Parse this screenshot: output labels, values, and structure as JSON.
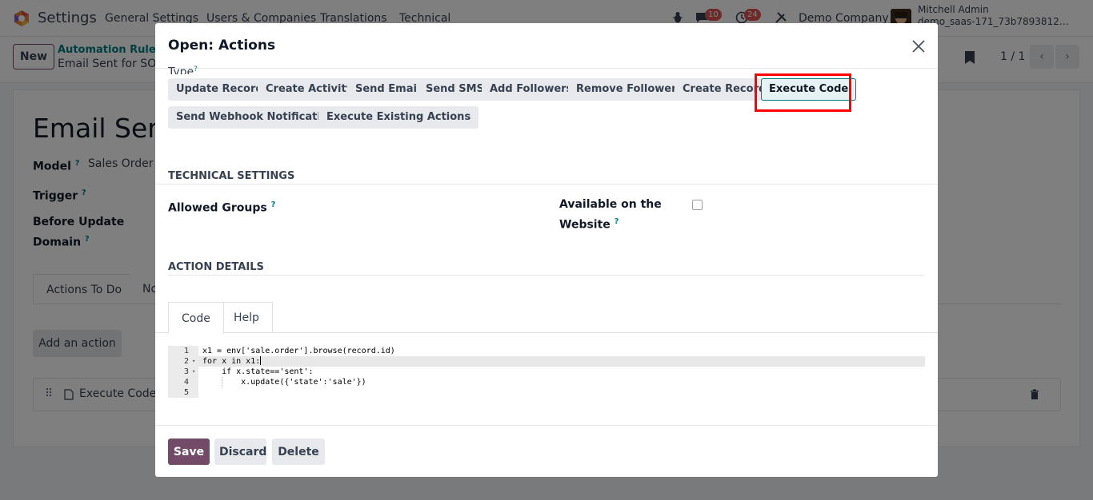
{
  "navbar": {
    "app_name": "Settings",
    "menus": [
      "General Settings",
      "Users & Companies",
      "Translations",
      "Technical"
    ],
    "messages_count": "10",
    "activities_count": "24",
    "company": "Demo Company",
    "user_name": "Mitchell Admin",
    "database": "demo_saas-171_73b7893812…"
  },
  "control_panel": {
    "new_label": "New",
    "breadcrumb_parent": "Automation Rules",
    "breadcrumb_current": "Email Sent for SO",
    "pager": "1 / 1"
  },
  "background_form": {
    "title": "Email Sent",
    "model_label": "Model",
    "model_value": "Sales Order",
    "trigger_label": "Trigger",
    "before_update_label": "Before Update",
    "domain_label": "Domain",
    "tab_actions": "Actions To Do",
    "tab_notes": "No",
    "add_action_label": "Add an action",
    "action_row_label": "Execute Code"
  },
  "modal": {
    "title": "Open: Actions",
    "type_label": "Type",
    "type_options": [
      "Update Record",
      "Create Activity",
      "Send Email",
      "Send SMS",
      "Add Followers",
      "Remove Followers",
      "Create Record",
      "Execute Code",
      "Send Webhook Notification",
      "Execute Existing Actions"
    ],
    "selected_type": "Execute Code",
    "technical_settings_title": "TECHNICAL SETTINGS",
    "allowed_groups_label": "Allowed Groups",
    "available_label_1": "Available on the",
    "available_label_2": "Website",
    "help_mark": "?",
    "action_details_title": "ACTION DETAILS",
    "tabs": [
      "Code",
      "Help"
    ],
    "code_lines": [
      "x1 = env['sale.order'].browse(record.id)",
      "for x in x1:",
      "    if x.state=='sent':",
      "        x.update({'state':'sale'})",
      ""
    ],
    "line_numbers": [
      "1",
      "2",
      "3",
      "4",
      "5"
    ],
    "footer": {
      "save": "Save",
      "discard": "Discard",
      "delete": "Delete"
    }
  },
  "colors": {
    "brand": "#714b67",
    "accent": "#017e84",
    "highlight": "#ff0000",
    "badge": "#e15252"
  }
}
